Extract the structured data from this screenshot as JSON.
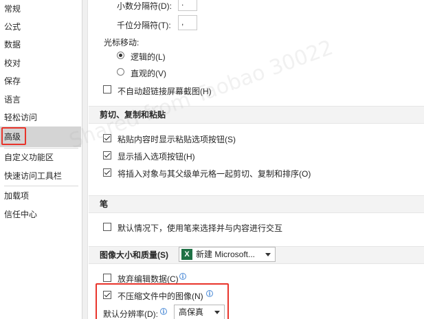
{
  "sidebar": {
    "items": [
      {
        "label": "常规"
      },
      {
        "label": "公式"
      },
      {
        "label": "数据"
      },
      {
        "label": "校对"
      },
      {
        "label": "保存"
      },
      {
        "label": "语言"
      },
      {
        "label": "轻松访问"
      },
      {
        "label": "高级",
        "selected": true
      },
      {
        "label": "自定义功能区"
      },
      {
        "label": "快速访问工具栏"
      },
      {
        "label": "加载项"
      },
      {
        "label": "信任中心"
      }
    ]
  },
  "editing": {
    "decimal_separator_label": "小数分隔符(D):",
    "decimal_separator_value": ".",
    "thousands_separator_label": "千位分隔符(T):",
    "thousands_separator_value": ",",
    "cursor_movement_label": "光标移动:",
    "logical_label": "逻辑的(L)",
    "visual_label": "直观的(V)",
    "selected_cursor_mode": "logical",
    "no_autohyperlink_label": "不自动超链接屏幕截图(H)",
    "no_autohyperlink_checked": false
  },
  "cut_copy_paste": {
    "header": "剪切、复制和粘贴",
    "items": [
      {
        "label": "粘贴内容时显示粘贴选项按钮(S)",
        "checked": true
      },
      {
        "label": "显示插入选项按钮(H)",
        "checked": true
      },
      {
        "label": "将插入对象与其父级单元格一起剪切、复制和排序(O)",
        "checked": true
      }
    ]
  },
  "pen": {
    "header": "笔",
    "default_pen_label": "默认情况下，使用笔来选择并与内容进行交互",
    "default_pen_checked": false
  },
  "image_quality": {
    "header": "图像大小和质量(S)",
    "document_value": "新建 Microsoft...",
    "excel_icon_text": "X",
    "discard_editing_label": "放弃编辑数据(C)",
    "discard_editing_checked": false,
    "no_compress_label": "不压缩文件中的图像(N)",
    "no_compress_checked": true,
    "default_resolution_label": "默认分辨率(D):",
    "default_resolution_value": "高保真"
  },
  "watermark_text": "Shared from Taobao 30022"
}
